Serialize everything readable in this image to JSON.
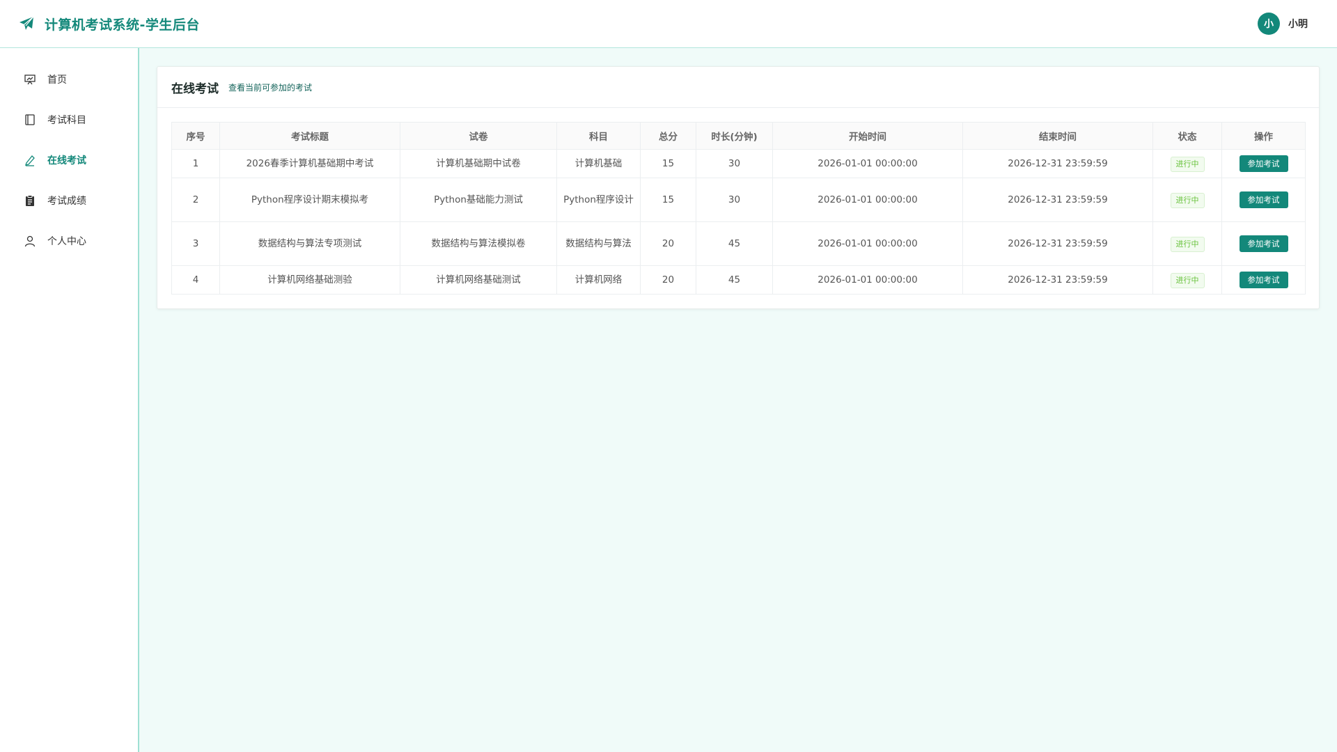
{
  "header": {
    "title": "计算机考试系统-学生后台",
    "avatar_char": "小",
    "username": "小明"
  },
  "colors": {
    "brand": "#13887a",
    "background": "#f0fbf9",
    "status_green": "#67c23a"
  },
  "sidebar": {
    "items": [
      {
        "label": "首页",
        "icon": "dashboard-icon",
        "active": false
      },
      {
        "label": "考试科目",
        "icon": "book-icon",
        "active": false
      },
      {
        "label": "在线考试",
        "icon": "pen-icon",
        "active": true
      },
      {
        "label": "考试成绩",
        "icon": "clipboard-icon",
        "active": false
      },
      {
        "label": "个人中心",
        "icon": "user-icon",
        "active": false
      }
    ]
  },
  "main": {
    "title": "在线考试",
    "subtitle": "查看当前可参加的考试",
    "table": {
      "columns": [
        "序号",
        "考试标题",
        "试卷",
        "科目",
        "总分",
        "时长(分钟)",
        "开始时间",
        "结束时间",
        "状态",
        "操作"
      ],
      "rows": [
        {
          "no": "1",
          "title": "2026春季计算机基础期中考试",
          "paper": "计算机基础期中试卷",
          "subject": "计算机基础",
          "score": "15",
          "duration": "30",
          "start": "2026-01-01 00:00:00",
          "end": "2026-12-31 23:59:59",
          "status": "进行中",
          "action": "参加考试"
        },
        {
          "no": "2",
          "title": "Python程序设计期末模拟考",
          "paper": "Python基础能力测试",
          "subject": "Python程序设计",
          "score": "15",
          "duration": "30",
          "start": "2026-01-01 00:00:00",
          "end": "2026-12-31 23:59:59",
          "status": "进行中",
          "action": "参加考试"
        },
        {
          "no": "3",
          "title": "数据结构与算法专项测试",
          "paper": "数据结构与算法模拟卷",
          "subject": "数据结构与算法",
          "score": "20",
          "duration": "45",
          "start": "2026-01-01 00:00:00",
          "end": "2026-12-31 23:59:59",
          "status": "进行中",
          "action": "参加考试"
        },
        {
          "no": "4",
          "title": "计算机网络基础测验",
          "paper": "计算机网络基础测试",
          "subject": "计算机网络",
          "score": "20",
          "duration": "45",
          "start": "2026-01-01 00:00:00",
          "end": "2026-12-31 23:59:59",
          "status": "进行中",
          "action": "参加考试"
        }
      ]
    }
  }
}
